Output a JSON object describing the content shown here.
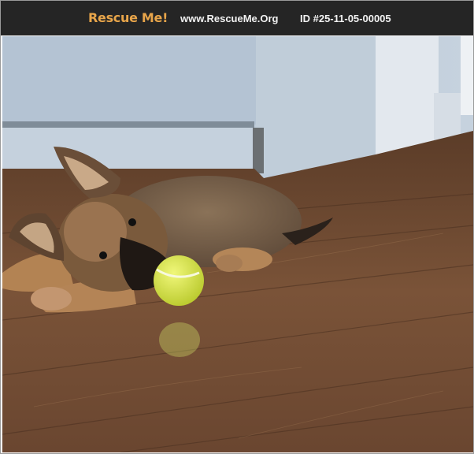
{
  "header": {
    "brand": "Rescue Me!",
    "site": "www.RescueMe.Org",
    "listing_id": "ID #25-11-05-00005"
  },
  "photo": {
    "subject": "puppy-with-tennis-ball"
  },
  "colors": {
    "header_bg": "#252525",
    "brand": "#e8a54a",
    "header_text": "#f2f2f2",
    "floor": "#6e4a33",
    "wall": "#b9c7d6",
    "ball": "#d9e84a"
  }
}
